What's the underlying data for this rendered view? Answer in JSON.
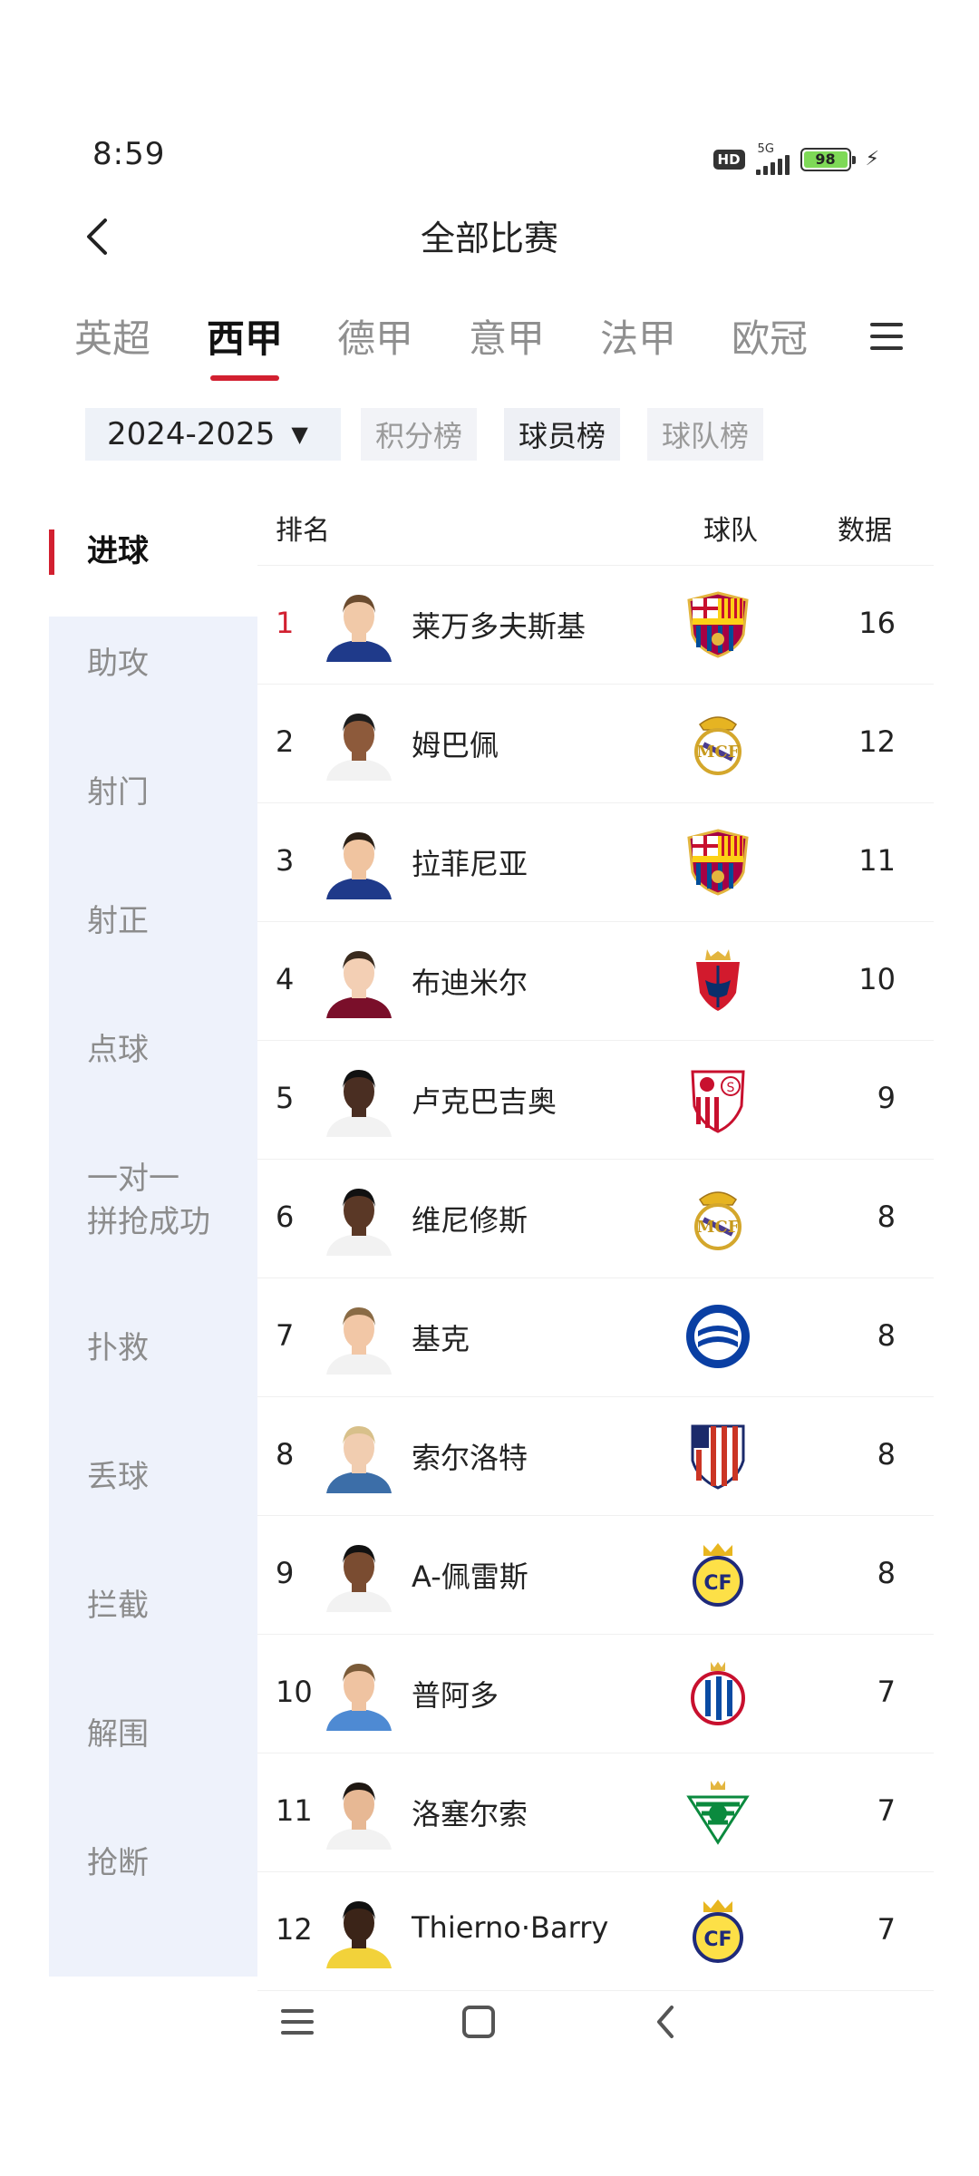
{
  "status": {
    "time": "8:59",
    "hd": "HD",
    "network": "5G",
    "battery": "98"
  },
  "header": {
    "title": "全部比赛"
  },
  "league_tabs": [
    {
      "label": "英超",
      "active": false
    },
    {
      "label": "西甲",
      "active": true
    },
    {
      "label": "德甲",
      "active": false
    },
    {
      "label": "意甲",
      "active": false
    },
    {
      "label": "法甲",
      "active": false
    },
    {
      "label": "欧冠",
      "active": false
    }
  ],
  "filters": {
    "season": "2024-2025",
    "chips": [
      {
        "label": "积分榜",
        "active": false
      },
      {
        "label": "球员榜",
        "active": true
      },
      {
        "label": "球队榜",
        "active": false
      }
    ]
  },
  "categories": [
    {
      "label": "进球",
      "active": true
    },
    {
      "label": "助攻",
      "active": false
    },
    {
      "label": "射门",
      "active": false
    },
    {
      "label": "射正",
      "active": false
    },
    {
      "label": "点球",
      "active": false
    },
    {
      "label": "一对一",
      "label2": "拼抢成功",
      "active": false
    },
    {
      "label": "扑救",
      "active": false
    },
    {
      "label": "丢球",
      "active": false
    },
    {
      "label": "拦截",
      "active": false
    },
    {
      "label": "解围",
      "active": false
    },
    {
      "label": "抢断",
      "active": false
    }
  ],
  "table": {
    "headers": {
      "rank": "排名",
      "team": "球队",
      "data": "数据"
    },
    "rows": [
      {
        "rank": "1",
        "name": "莱万多夫斯基",
        "team_icon": "barcelona-crest",
        "value": "16"
      },
      {
        "rank": "2",
        "name": "姆巴佩",
        "team_icon": "real-madrid-crest",
        "value": "12"
      },
      {
        "rank": "3",
        "name": "拉菲尼亚",
        "team_icon": "barcelona-crest",
        "value": "11"
      },
      {
        "rank": "4",
        "name": "布迪米尔",
        "team_icon": "osasuna-crest",
        "value": "10"
      },
      {
        "rank": "5",
        "name": "卢克巴吉奥",
        "team_icon": "sevilla-crest",
        "value": "9"
      },
      {
        "rank": "6",
        "name": "维尼修斯",
        "team_icon": "real-madrid-crest",
        "value": "8"
      },
      {
        "rank": "7",
        "name": "基克",
        "team_icon": "alaves-crest",
        "value": "8"
      },
      {
        "rank": "8",
        "name": "索尔洛特",
        "team_icon": "atletico-madrid-crest",
        "value": "8"
      },
      {
        "rank": "9",
        "name": "A-佩雷斯",
        "team_icon": "villarreal-crest",
        "value": "8"
      },
      {
        "rank": "10",
        "name": "普阿多",
        "team_icon": "espanyol-crest",
        "value": "7"
      },
      {
        "rank": "11",
        "name": "洛塞尔索",
        "team_icon": "real-betis-crest",
        "value": "7"
      },
      {
        "rank": "12",
        "name": "Thierno·Barry",
        "team_icon": "villarreal-crest",
        "value": "7"
      }
    ]
  },
  "colors": {
    "accent": "#d22030",
    "side_bg": "#eef2fb",
    "chip_bg": "#f2f3f7"
  }
}
